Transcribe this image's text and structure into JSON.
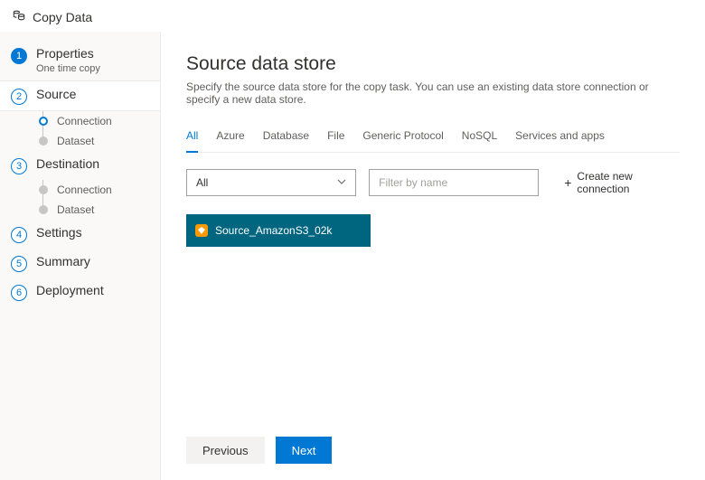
{
  "header": {
    "title": "Copy Data"
  },
  "sidebar": {
    "steps": [
      {
        "label": "Properties",
        "sub": "One time copy"
      },
      {
        "label": "Source"
      },
      {
        "label": "Destination"
      },
      {
        "label": "Settings"
      },
      {
        "label": "Summary"
      },
      {
        "label": "Deployment"
      }
    ],
    "source_sub": [
      {
        "label": "Connection"
      },
      {
        "label": "Dataset"
      }
    ],
    "dest_sub": [
      {
        "label": "Connection"
      },
      {
        "label": "Dataset"
      }
    ]
  },
  "main": {
    "title": "Source data store",
    "description": "Specify the source data store for the copy task. You can use an existing data store connection or specify a new data store.",
    "tabs": [
      "All",
      "Azure",
      "Database",
      "File",
      "Generic Protocol",
      "NoSQL",
      "Services and apps"
    ],
    "type_filter": {
      "selected": "All"
    },
    "name_filter": {
      "placeholder": "Filter by name",
      "value": ""
    },
    "create_label": "Create new connection",
    "connections": [
      {
        "name": "Source_AmazonS3_02k"
      }
    ]
  },
  "footer": {
    "previous": "Previous",
    "next": "Next"
  }
}
